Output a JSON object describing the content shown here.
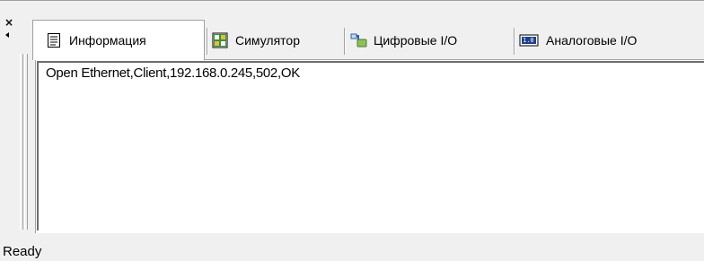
{
  "dock": {
    "close_glyph": "×",
    "close_icon": "close-icon",
    "pin_icon": "collapse-arrow-icon"
  },
  "tabs": [
    {
      "label": "Информация",
      "icon": "document-icon",
      "active": true
    },
    {
      "label": "Симулятор",
      "icon": "simulator-icon",
      "active": false
    },
    {
      "label": "Цифровые I/O",
      "icon": "digital-io-icon",
      "active": false
    },
    {
      "label": "Аналоговые I/O",
      "icon": "analog-io-icon",
      "active": false,
      "icon_text": "1.0"
    }
  ],
  "log": {
    "lines": [
      "Open Ethernet,Client,192.168.0.245,502,OK"
    ]
  },
  "statusbar": {
    "text": "Ready"
  },
  "colors": {
    "face": "#f0f0f0",
    "border": "#a0a0a0",
    "text": "#000000",
    "accent": "#2a5fa8"
  }
}
